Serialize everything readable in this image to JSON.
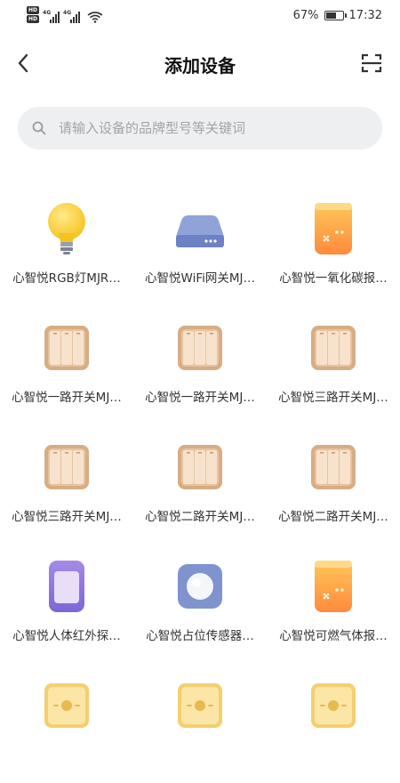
{
  "status_bar": {
    "network_1": "4G",
    "network_2": "4G",
    "battery_level": 0.67,
    "battery_text": "67%",
    "time": "17:32"
  },
  "header": {
    "title": "添加设备"
  },
  "search": {
    "placeholder": "请输入设备的品牌型号等关键词"
  },
  "devices": [
    {
      "name": "心智悦RGB灯MJR…",
      "icon": "bulb-icon"
    },
    {
      "name": "心智悦WiFi网关MJ…",
      "icon": "gateway-icon"
    },
    {
      "name": "心智悦一氧化碳报…",
      "icon": "co-alarm-icon"
    },
    {
      "name": "心智悦一路开关MJ…",
      "icon": "wall-switch-icon"
    },
    {
      "name": "心智悦一路开关MJ…",
      "icon": "wall-switch-icon"
    },
    {
      "name": "心智悦三路开关MJ…",
      "icon": "wall-switch-icon"
    },
    {
      "name": "心智悦三路开关MJ…",
      "icon": "wall-switch-icon"
    },
    {
      "name": "心智悦二路开关MJ…",
      "icon": "wall-switch-icon"
    },
    {
      "name": "心智悦二路开关MJ…",
      "icon": "wall-switch-icon"
    },
    {
      "name": "心智悦人体红外探…",
      "icon": "motion-sensor-icon"
    },
    {
      "name": "心智悦占位传感器…",
      "icon": "occupancy-sensor-icon"
    },
    {
      "name": "心智悦可燃气体报…",
      "icon": "gas-alarm-icon"
    },
    {
      "name": "",
      "icon": "socket-icon"
    },
    {
      "name": "",
      "icon": "socket-icon"
    },
    {
      "name": "",
      "icon": "socket-icon"
    }
  ]
}
